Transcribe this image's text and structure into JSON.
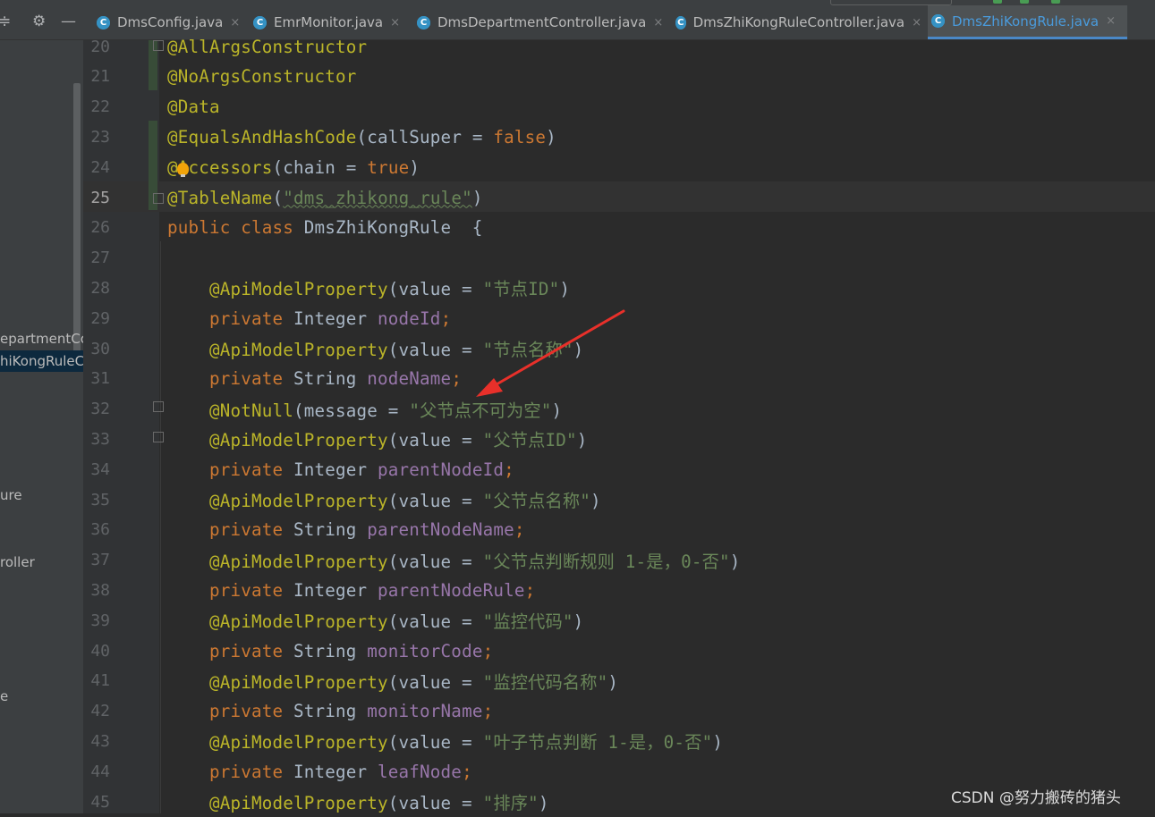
{
  "tabs": [
    {
      "label": "DmsConfig.java",
      "close": "×",
      "active": false
    },
    {
      "label": "EmrMonitor.java",
      "close": "×",
      "active": false
    },
    {
      "label": "DmsDepartmentController.java",
      "close": "×",
      "active": false
    },
    {
      "label": "DmsZhiKongRuleController.java",
      "close": "×",
      "active": false
    },
    {
      "label": "DmsZhiKongRule.java",
      "close": "×",
      "active": true
    }
  ],
  "tab_icon_letter": "C",
  "project_panel": {
    "items": [
      {
        "label": "epartmentCo",
        "selected": false
      },
      {
        "label": "hiKongRuleCo",
        "selected": true
      },
      {
        "label": "ure",
        "selected": false
      },
      {
        "label": "roller",
        "selected": false
      },
      {
        "label": "e",
        "selected": false
      }
    ]
  },
  "editor": {
    "current_line": "25",
    "lines": [
      {
        "n": "20",
        "tokens": [
          {
            "t": "@AllArgsConstructor",
            "c": "ann"
          }
        ]
      },
      {
        "n": "21",
        "tokens": [
          {
            "t": "@NoArgsConstructor",
            "c": "ann"
          }
        ]
      },
      {
        "n": "22",
        "tokens": [
          {
            "t": "@Data",
            "c": "ann"
          }
        ]
      },
      {
        "n": "23",
        "tokens": [
          {
            "t": "@EqualsAndHashCode",
            "c": "ann"
          },
          {
            "t": "(callSuper = ",
            "c": "plain"
          },
          {
            "t": "false",
            "c": "kw"
          },
          {
            "t": ")",
            "c": "plain"
          }
        ]
      },
      {
        "n": "24",
        "tokens": [
          {
            "t": "@Accessors",
            "c": "ann"
          },
          {
            "t": "(chain = ",
            "c": "plain"
          },
          {
            "t": "true",
            "c": "kw"
          },
          {
            "t": ")",
            "c": "plain"
          }
        ]
      },
      {
        "n": "25",
        "tokens": [
          {
            "t": "@TableName",
            "c": "ann"
          },
          {
            "t": "(",
            "c": "plain"
          },
          {
            "t": "\"dms_zhikong_rule\"",
            "c": "str"
          },
          {
            "t": ")",
            "c": "plain"
          }
        ]
      },
      {
        "n": "26",
        "tokens": [
          {
            "t": "public class ",
            "c": "kw"
          },
          {
            "t": "DmsZhiKongRule  {",
            "c": "plain"
          }
        ]
      },
      {
        "n": "27",
        "tokens": []
      },
      {
        "n": "28",
        "tokens": [
          {
            "t": "    @ApiModelProperty",
            "c": "ann"
          },
          {
            "t": "(value = ",
            "c": "plain"
          },
          {
            "t": "\"节点ID\"",
            "c": "str"
          },
          {
            "t": ")",
            "c": "plain"
          }
        ]
      },
      {
        "n": "29",
        "tokens": [
          {
            "t": "    private ",
            "c": "kw"
          },
          {
            "t": "Integer ",
            "c": "plain"
          },
          {
            "t": "nodeId",
            "c": "fld"
          },
          {
            "t": ";",
            "c": "kw"
          }
        ]
      },
      {
        "n": "30",
        "tokens": [
          {
            "t": "    @ApiModelProperty",
            "c": "ann"
          },
          {
            "t": "(value = ",
            "c": "plain"
          },
          {
            "t": "\"节点名称\"",
            "c": "str"
          },
          {
            "t": ")",
            "c": "plain"
          }
        ]
      },
      {
        "n": "31",
        "tokens": [
          {
            "t": "    private ",
            "c": "kw"
          },
          {
            "t": "String ",
            "c": "plain"
          },
          {
            "t": "nodeName",
            "c": "fld"
          },
          {
            "t": ";",
            "c": "kw"
          }
        ]
      },
      {
        "n": "32",
        "tokens": [
          {
            "t": "    @NotNull",
            "c": "ann"
          },
          {
            "t": "(message = ",
            "c": "plain"
          },
          {
            "t": "\"父节点不可为空\"",
            "c": "str"
          },
          {
            "t": ")",
            "c": "plain"
          }
        ]
      },
      {
        "n": "33",
        "tokens": [
          {
            "t": "    @ApiModelProperty",
            "c": "ann"
          },
          {
            "t": "(value = ",
            "c": "plain"
          },
          {
            "t": "\"父节点ID\"",
            "c": "str"
          },
          {
            "t": ")",
            "c": "plain"
          }
        ]
      },
      {
        "n": "34",
        "tokens": [
          {
            "t": "    private ",
            "c": "kw"
          },
          {
            "t": "Integer ",
            "c": "plain"
          },
          {
            "t": "parentNodeId",
            "c": "fld"
          },
          {
            "t": ";",
            "c": "kw"
          }
        ]
      },
      {
        "n": "35",
        "tokens": [
          {
            "t": "    @ApiModelProperty",
            "c": "ann"
          },
          {
            "t": "(value = ",
            "c": "plain"
          },
          {
            "t": "\"父节点名称\"",
            "c": "str"
          },
          {
            "t": ")",
            "c": "plain"
          }
        ]
      },
      {
        "n": "36",
        "tokens": [
          {
            "t": "    private ",
            "c": "kw"
          },
          {
            "t": "String ",
            "c": "plain"
          },
          {
            "t": "parentNodeName",
            "c": "fld"
          },
          {
            "t": ";",
            "c": "kw"
          }
        ]
      },
      {
        "n": "37",
        "tokens": [
          {
            "t": "    @ApiModelProperty",
            "c": "ann"
          },
          {
            "t": "(value = ",
            "c": "plain"
          },
          {
            "t": "\"父节点判断规则 1-是，0-否\"",
            "c": "str"
          },
          {
            "t": ")",
            "c": "plain"
          }
        ]
      },
      {
        "n": "38",
        "tokens": [
          {
            "t": "    private ",
            "c": "kw"
          },
          {
            "t": "Integer ",
            "c": "plain"
          },
          {
            "t": "parentNodeRule",
            "c": "fld"
          },
          {
            "t": ";",
            "c": "kw"
          }
        ]
      },
      {
        "n": "39",
        "tokens": [
          {
            "t": "    @ApiModelProperty",
            "c": "ann"
          },
          {
            "t": "(value = ",
            "c": "plain"
          },
          {
            "t": "\"监控代码\"",
            "c": "str"
          },
          {
            "t": ")",
            "c": "plain"
          }
        ]
      },
      {
        "n": "40",
        "tokens": [
          {
            "t": "    private ",
            "c": "kw"
          },
          {
            "t": "String ",
            "c": "plain"
          },
          {
            "t": "monitorCode",
            "c": "fld"
          },
          {
            "t": ";",
            "c": "kw"
          }
        ]
      },
      {
        "n": "41",
        "tokens": [
          {
            "t": "    @ApiModelProperty",
            "c": "ann"
          },
          {
            "t": "(value = ",
            "c": "plain"
          },
          {
            "t": "\"监控代码名称\"",
            "c": "str"
          },
          {
            "t": ")",
            "c": "plain"
          }
        ]
      },
      {
        "n": "42",
        "tokens": [
          {
            "t": "    private ",
            "c": "kw"
          },
          {
            "t": "String ",
            "c": "plain"
          },
          {
            "t": "monitorName",
            "c": "fld"
          },
          {
            "t": ";",
            "c": "kw"
          }
        ]
      },
      {
        "n": "43",
        "tokens": [
          {
            "t": "    @ApiModelProperty",
            "c": "ann"
          },
          {
            "t": "(value = ",
            "c": "plain"
          },
          {
            "t": "\"叶子节点判断 1-是，0-否\"",
            "c": "str"
          },
          {
            "t": ")",
            "c": "plain"
          }
        ]
      },
      {
        "n": "44",
        "tokens": [
          {
            "t": "    private ",
            "c": "kw"
          },
          {
            "t": "Integer ",
            "c": "plain"
          },
          {
            "t": "leafNode",
            "c": "fld"
          },
          {
            "t": ";",
            "c": "kw"
          }
        ]
      },
      {
        "n": "45",
        "tokens": [
          {
            "t": "    @ApiModelProperty",
            "c": "ann"
          },
          {
            "t": "(value = ",
            "c": "plain"
          },
          {
            "t": "\"排序\"",
            "c": "str"
          },
          {
            "t": ")",
            "c": "plain"
          }
        ]
      }
    ]
  },
  "watermark": "CSDN @努力搬砖的猪头",
  "colors": {
    "annotation": "#bbb529",
    "keyword": "#cc7832",
    "string": "#6a8759",
    "field": "#9876aa",
    "arrow": "#e8302a",
    "tab_active_text": "#4a9bdc"
  }
}
